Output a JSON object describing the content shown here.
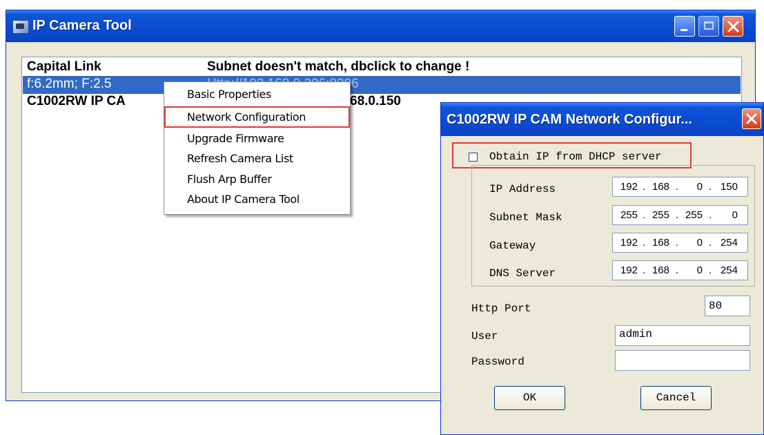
{
  "main_window": {
    "title": "IP Camera Tool"
  },
  "camera_list": {
    "rows": [
      {
        "col1": "Capital Link",
        "col2": "Subnet doesn't match, dbclick to change !"
      },
      {
        "col1": "f:6.2mm; F:2.5",
        "col2": "Http://192.168.0.206:8206"
      },
      {
        "col1": "C1002RW IP CA",
        "col2": "68.0.150"
      }
    ]
  },
  "context_menu": {
    "items": [
      "Basic Properties",
      "Network Configuration",
      "Upgrade Firmware",
      "Refresh Camera List",
      "Flush Arp Buffer",
      "About IP Camera Tool"
    ],
    "highlighted": "Network Configuration"
  },
  "dialog": {
    "title": "C1002RW IP CAM Network Configur...",
    "dhcp_label": "Obtain IP from DHCP server",
    "dhcp_checked": false,
    "ip_address": {
      "label": "IP Address",
      "octets": [
        "192",
        "168",
        "0",
        "150"
      ]
    },
    "subnet_mask": {
      "label": "Subnet Mask",
      "octets": [
        "255",
        "255",
        "255",
        "0"
      ]
    },
    "gateway": {
      "label": "Gateway",
      "octets": [
        "192",
        "168",
        "0",
        "254"
      ]
    },
    "dns_server": {
      "label": "DNS Server",
      "octets": [
        "192",
        "168",
        "0",
        "254"
      ]
    },
    "http_port": {
      "label": "Http Port",
      "value": "80"
    },
    "user": {
      "label": "User",
      "value": "admin"
    },
    "password": {
      "label": "Password",
      "value": ""
    },
    "ok_label": "OK",
    "cancel_label": "Cancel"
  },
  "colors": {
    "titlebar_blue": "#0a4bd0",
    "selection_blue": "#3169c6",
    "highlight_red": "#e03838",
    "dialog_face": "#ece9d8"
  }
}
